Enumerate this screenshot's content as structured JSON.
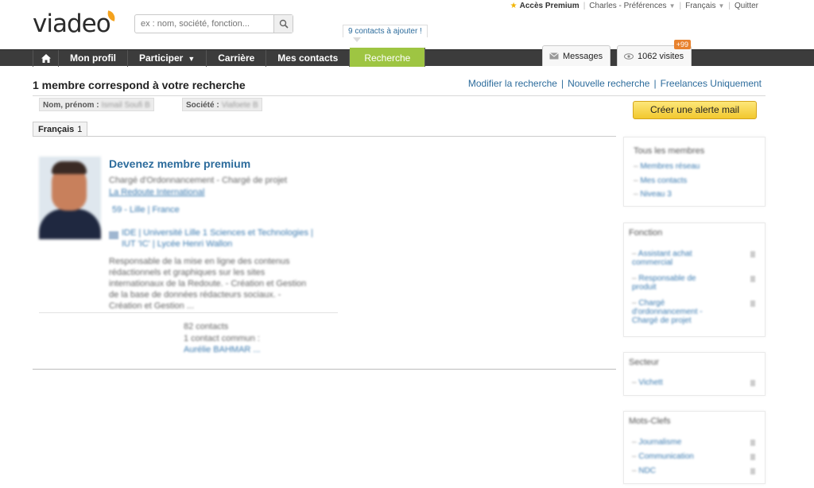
{
  "header": {
    "logo": "viadeo",
    "search_placeholder": "ex : nom, société, fonction...",
    "premium_label": "Accès Premium",
    "user_label": "Charles - Préférences",
    "language_label": "Français",
    "quit_label": "Quitter",
    "add_contacts_label": "9 contacts à ajouter !"
  },
  "nav": {
    "items": [
      "Mon profil",
      "Participer",
      "Carrière",
      "Mes contacts",
      "Recherche"
    ],
    "messages_label": "Messages",
    "visits_label": "1062 visites",
    "visits_badge": "+99"
  },
  "results": {
    "title": "1 membre correspond à votre recherche",
    "links": [
      "Modifier la recherche",
      "Nouvelle recherche",
      "Freelances Uniquement"
    ],
    "filters": [
      {
        "label": "Nom, prénom :",
        "value": "Ismail Soufi B"
      },
      {
        "label": "Société :",
        "value": "Viafoete B"
      }
    ],
    "alert_button": "Créer une alerte mail",
    "language_tab": {
      "label": "Français",
      "count": "1"
    }
  },
  "member": {
    "title": "Devenez membre premium",
    "lines": [
      "Chargé d'Ordonnancement - Chargé de projet",
      "La Redoute International",
      "59 - Lille | France",
      "IDE | Université Lille 1 Sciences et Technologies |",
      "IUT 'IC' | Lycée Henri Wallon",
      "Responsable de la mise en ligne des contenus",
      "rédactionnels et graphiques sur les sites",
      "internationaux de la Redoute. - Création et Gestion",
      "de la base de données rédacteurs sociaux. -",
      "Création et Gestion ...",
      "82 contacts",
      "1 contact commun :",
      "Aurélie BAHMAR ..."
    ]
  },
  "sidebar": {
    "boxes": [
      {
        "title": "Tous les membres",
        "items": [
          "Membres réseau",
          "Mes contacts",
          "Niveau 3"
        ]
      },
      {
        "title": "Fonction",
        "items": [
          "Assistant achat commercial",
          "Responsable de produit",
          "Chargé d'ordonnancement - Chargé de projet"
        ]
      },
      {
        "title": "Secteur",
        "items": [
          "Vichett"
        ]
      },
      {
        "title": "Mots-Clefs",
        "items": [
          "Journalisme",
          "Communication",
          "NDC"
        ]
      }
    ]
  },
  "colors": {
    "nav_bg": "#3c3c3c",
    "nav_active": "#9ec542",
    "link": "#2d6c9c",
    "alert_button": "#f5d245",
    "badge": "#e8822e"
  }
}
